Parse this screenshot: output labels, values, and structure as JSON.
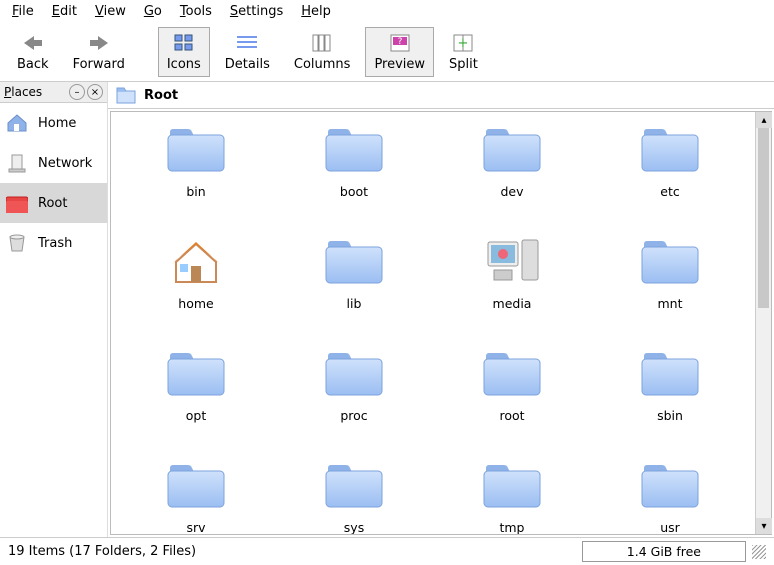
{
  "menu": {
    "file": "File",
    "edit": "Edit",
    "view": "View",
    "go": "Go",
    "tools": "Tools",
    "settings": "Settings",
    "help": "Help"
  },
  "toolbar": {
    "back": "Back",
    "forward": "Forward",
    "icons": "Icons",
    "details": "Details",
    "columns": "Columns",
    "preview": "Preview",
    "split": "Split"
  },
  "sidebar": {
    "title": "Places",
    "items": [
      {
        "label": "Home",
        "icon": "house"
      },
      {
        "label": "Network",
        "icon": "network"
      },
      {
        "label": "Root",
        "icon": "rootfolder"
      },
      {
        "label": "Trash",
        "icon": "trash"
      }
    ]
  },
  "path": {
    "title": "Root"
  },
  "files": [
    {
      "name": "bin",
      "icon": "folder"
    },
    {
      "name": "boot",
      "icon": "folder"
    },
    {
      "name": "dev",
      "icon": "folder"
    },
    {
      "name": "etc",
      "icon": "folder"
    },
    {
      "name": "home",
      "icon": "homefolder"
    },
    {
      "name": "lib",
      "icon": "folder"
    },
    {
      "name": "media",
      "icon": "computer"
    },
    {
      "name": "mnt",
      "icon": "folder"
    },
    {
      "name": "opt",
      "icon": "folder"
    },
    {
      "name": "proc",
      "icon": "folder"
    },
    {
      "name": "root",
      "icon": "folder"
    },
    {
      "name": "sbin",
      "icon": "folder"
    },
    {
      "name": "srv",
      "icon": "folder"
    },
    {
      "name": "sys",
      "icon": "folder"
    },
    {
      "name": "tmp",
      "icon": "folder"
    },
    {
      "name": "usr",
      "icon": "folder"
    }
  ],
  "status": {
    "items": "19 Items (17 Folders, 2 Files)",
    "free": "1.4 GiB free"
  }
}
